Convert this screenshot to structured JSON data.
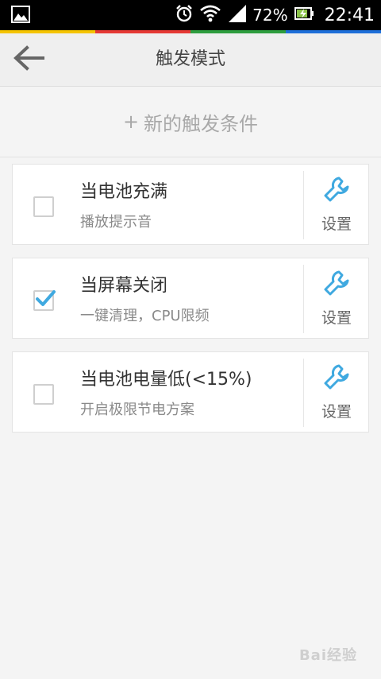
{
  "status_bar": {
    "battery_percent": "72%",
    "time": "22:41",
    "stripe_colors": [
      "#f5c400",
      "#e53935",
      "#2e9e3f",
      "#1e6fd9"
    ]
  },
  "header": {
    "title": "触发模式",
    "back_icon": "arrow-left-icon"
  },
  "add_row": {
    "plus": "+",
    "label": "新的触发条件"
  },
  "triggers": [
    {
      "title": "当电池充满",
      "subtitle": "播放提示音",
      "checked": false,
      "settings_label": "设置"
    },
    {
      "title": "当屏幕关闭",
      "subtitle": "一键清理，CPU限频",
      "checked": true,
      "settings_label": "设置"
    },
    {
      "title": "当电池电量低(<15%)",
      "subtitle": "开启极限节电方案",
      "checked": false,
      "settings_label": "设置"
    }
  ],
  "colors": {
    "accent": "#3fa9e0",
    "background": "#f4f4f4"
  },
  "watermark": "Bai经验"
}
